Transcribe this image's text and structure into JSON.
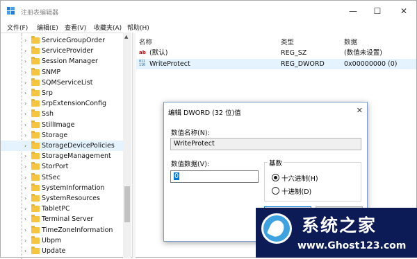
{
  "window": {
    "title": "注册表编辑器",
    "controls": [
      "—",
      "☐",
      "✕"
    ]
  },
  "menu": [
    "文件(F)",
    "编辑(E)",
    "查看(V)",
    "收藏夹(A)",
    "帮助(H)"
  ],
  "tree": {
    "items": [
      {
        "label": "ServiceGroupOrder",
        "selected": false
      },
      {
        "label": "ServiceProvider",
        "selected": false
      },
      {
        "label": "Session Manager",
        "selected": false
      },
      {
        "label": "SNMP",
        "selected": false
      },
      {
        "label": "SQMServiceList",
        "selected": false
      },
      {
        "label": "Srp",
        "selected": false
      },
      {
        "label": "SrpExtensionConfig",
        "selected": false
      },
      {
        "label": "Ssh",
        "selected": false
      },
      {
        "label": "StillImage",
        "selected": false
      },
      {
        "label": "Storage",
        "selected": false
      },
      {
        "label": "StorageDevicePolicies",
        "selected": true
      },
      {
        "label": "StorageManagement",
        "selected": false
      },
      {
        "label": "StorPort",
        "selected": false
      },
      {
        "label": "StSec",
        "selected": false
      },
      {
        "label": "SystemInformation",
        "selected": false
      },
      {
        "label": "SystemResources",
        "selected": false
      },
      {
        "label": "TabletPC",
        "selected": false
      },
      {
        "label": "Terminal Server",
        "selected": false
      },
      {
        "label": "TimeZoneInformation",
        "selected": false
      },
      {
        "label": "Ubpm",
        "selected": false
      },
      {
        "label": "Update",
        "selected": false
      }
    ]
  },
  "list": {
    "headers": {
      "name": "名称",
      "type": "类型",
      "data": "数据"
    },
    "rows": [
      {
        "icon": "string-value-icon",
        "name": "(默认)",
        "type": "REG_SZ",
        "data": "(数值未设置)"
      },
      {
        "icon": "binary-value-icon",
        "name": "WriteProtect",
        "type": "REG_DWORD",
        "data": "0x00000000 (0)"
      }
    ]
  },
  "dialog": {
    "title": "编辑 DWORD (32 位)值",
    "close": "✕",
    "name_label": "数值名称(N):",
    "name_value": "WriteProtect",
    "data_label": "数值数据(V):",
    "data_value": "0",
    "base_label": "基数",
    "base_options": [
      {
        "label": "十六进制(H)",
        "checked": true
      },
      {
        "label": "十进制(D)",
        "checked": false
      }
    ]
  },
  "watermark": {
    "title": "系统之家",
    "url": "www.Ghost123.com"
  }
}
